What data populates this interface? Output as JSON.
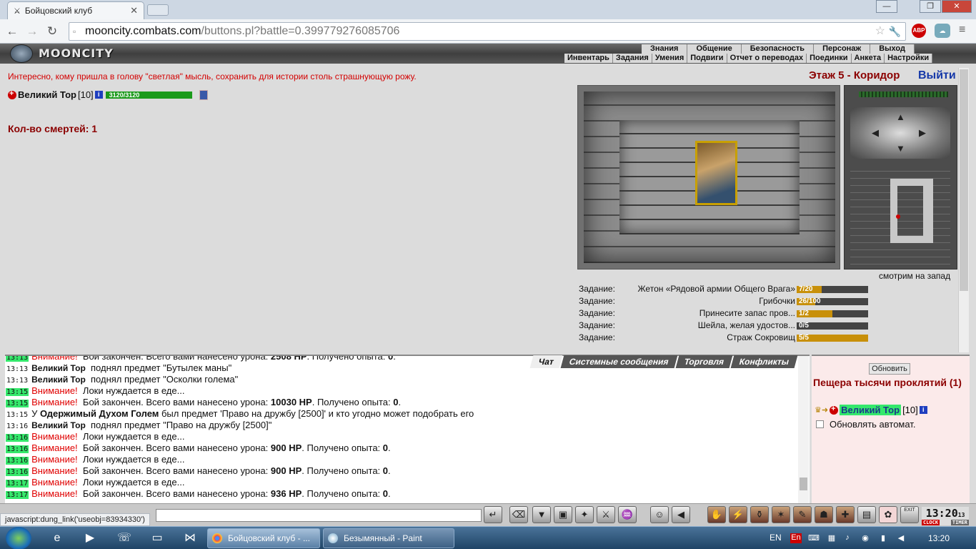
{
  "browser": {
    "tab_title": "Бойцовский клуб",
    "tab_close": "✕",
    "url_domain": "mooncity.combats.com",
    "url_rest": "/buttons.pl?battle=0.399779276085706",
    "win_min": "—",
    "win_max": "❐",
    "win_close": "✕"
  },
  "site": {
    "logo": "MOONCITY",
    "top_menu": [
      "Знания",
      "Общение",
      "Безопасность",
      "Персонаж",
      "Выход"
    ],
    "sub_menu": [
      "Инвентарь",
      "Задания",
      "Умения",
      "Подвиги",
      "Отчет о переводах",
      "Поединки",
      "Анкета",
      "Настройки"
    ]
  },
  "main": {
    "message": "Интересно, кому пришла в голову \"светлая\" мысль, сохранить для истории столь страшнующую рожу.",
    "floor": "Этаж 5 - Коридор",
    "exit": "Выйти",
    "player_name": "Великий Тор",
    "player_level": "[10]",
    "hp_text": "3120/3120",
    "hp_fraction": 1.0,
    "deaths": "Кол-во смертей: 1",
    "facing": "смотрим на запад",
    "tasks": [
      {
        "label": "Задание:",
        "name": "Жетон «Рядовой армии Общего Врага»",
        "count": "7/20",
        "fraction": 0.35
      },
      {
        "label": "Задание:",
        "name": "Грибочки",
        "count": "26/100",
        "fraction": 0.26
      },
      {
        "label": "Задание:",
        "name": "Принесите запас пров...",
        "count": "1/2",
        "fraction": 0.5
      },
      {
        "label": "Задание:",
        "name": "Шейла, желая удостов...",
        "count": "0/5",
        "fraction": 0.0
      },
      {
        "label": "Задание:",
        "name": "Страж Сокровищ",
        "count": "5/5",
        "fraction": 1.0
      }
    ]
  },
  "chat": {
    "tabs": [
      "Чат",
      "Системные сообщения",
      "Торговля",
      "Конфликты"
    ]
  },
  "right_panel": {
    "refresh": "Обновить",
    "location": "Пещера тысячи проклятий (1)",
    "member_name": "Великий Тор",
    "member_level": "[10]",
    "auto_update": "Обновлять автомат."
  },
  "chatbar": {
    "clock": "13:20",
    "clock_sec": "13",
    "clock_label": "CLOCK",
    "timer_label": "TIMER",
    "exit_label": "EXIT"
  },
  "statusbar": "javascript:dung_link('useobj=83934330')",
  "taskbar": {
    "chrome_task": "Бойцовский клуб - ...",
    "paint_task": "Безымянный - Paint",
    "lang": "EN",
    "time": "13:20"
  },
  "colors": {
    "warn": "#e00000",
    "time_green": "#35e86c",
    "floor": "#8b0000",
    "exit": "#1538a8"
  },
  "icons": {
    "cross": "red-cross-icon",
    "info": "info-icon"
  }
}
